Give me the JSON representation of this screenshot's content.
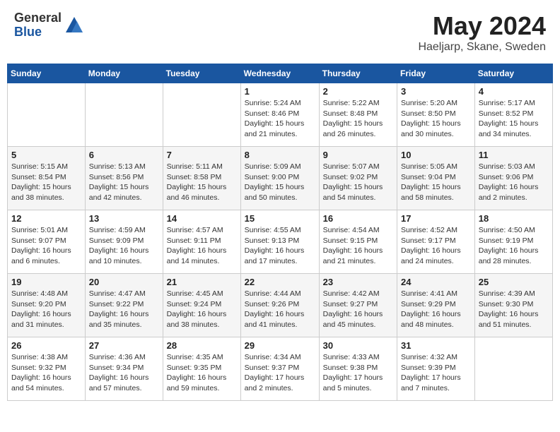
{
  "logo": {
    "general": "General",
    "blue": "Blue"
  },
  "title": "May 2024",
  "subtitle": "Haeljarp, Skane, Sweden",
  "days_header": [
    "Sunday",
    "Monday",
    "Tuesday",
    "Wednesday",
    "Thursday",
    "Friday",
    "Saturday"
  ],
  "weeks": [
    [
      {
        "num": "",
        "info": ""
      },
      {
        "num": "",
        "info": ""
      },
      {
        "num": "",
        "info": ""
      },
      {
        "num": "1",
        "info": "Sunrise: 5:24 AM\nSunset: 8:46 PM\nDaylight: 15 hours\nand 21 minutes."
      },
      {
        "num": "2",
        "info": "Sunrise: 5:22 AM\nSunset: 8:48 PM\nDaylight: 15 hours\nand 26 minutes."
      },
      {
        "num": "3",
        "info": "Sunrise: 5:20 AM\nSunset: 8:50 PM\nDaylight: 15 hours\nand 30 minutes."
      },
      {
        "num": "4",
        "info": "Sunrise: 5:17 AM\nSunset: 8:52 PM\nDaylight: 15 hours\nand 34 minutes."
      }
    ],
    [
      {
        "num": "5",
        "info": "Sunrise: 5:15 AM\nSunset: 8:54 PM\nDaylight: 15 hours\nand 38 minutes."
      },
      {
        "num": "6",
        "info": "Sunrise: 5:13 AM\nSunset: 8:56 PM\nDaylight: 15 hours\nand 42 minutes."
      },
      {
        "num": "7",
        "info": "Sunrise: 5:11 AM\nSunset: 8:58 PM\nDaylight: 15 hours\nand 46 minutes."
      },
      {
        "num": "8",
        "info": "Sunrise: 5:09 AM\nSunset: 9:00 PM\nDaylight: 15 hours\nand 50 minutes."
      },
      {
        "num": "9",
        "info": "Sunrise: 5:07 AM\nSunset: 9:02 PM\nDaylight: 15 hours\nand 54 minutes."
      },
      {
        "num": "10",
        "info": "Sunrise: 5:05 AM\nSunset: 9:04 PM\nDaylight: 15 hours\nand 58 minutes."
      },
      {
        "num": "11",
        "info": "Sunrise: 5:03 AM\nSunset: 9:06 PM\nDaylight: 16 hours\nand 2 minutes."
      }
    ],
    [
      {
        "num": "12",
        "info": "Sunrise: 5:01 AM\nSunset: 9:07 PM\nDaylight: 16 hours\nand 6 minutes."
      },
      {
        "num": "13",
        "info": "Sunrise: 4:59 AM\nSunset: 9:09 PM\nDaylight: 16 hours\nand 10 minutes."
      },
      {
        "num": "14",
        "info": "Sunrise: 4:57 AM\nSunset: 9:11 PM\nDaylight: 16 hours\nand 14 minutes."
      },
      {
        "num": "15",
        "info": "Sunrise: 4:55 AM\nSunset: 9:13 PM\nDaylight: 16 hours\nand 17 minutes."
      },
      {
        "num": "16",
        "info": "Sunrise: 4:54 AM\nSunset: 9:15 PM\nDaylight: 16 hours\nand 21 minutes."
      },
      {
        "num": "17",
        "info": "Sunrise: 4:52 AM\nSunset: 9:17 PM\nDaylight: 16 hours\nand 24 minutes."
      },
      {
        "num": "18",
        "info": "Sunrise: 4:50 AM\nSunset: 9:19 PM\nDaylight: 16 hours\nand 28 minutes."
      }
    ],
    [
      {
        "num": "19",
        "info": "Sunrise: 4:48 AM\nSunset: 9:20 PM\nDaylight: 16 hours\nand 31 minutes."
      },
      {
        "num": "20",
        "info": "Sunrise: 4:47 AM\nSunset: 9:22 PM\nDaylight: 16 hours\nand 35 minutes."
      },
      {
        "num": "21",
        "info": "Sunrise: 4:45 AM\nSunset: 9:24 PM\nDaylight: 16 hours\nand 38 minutes."
      },
      {
        "num": "22",
        "info": "Sunrise: 4:44 AM\nSunset: 9:26 PM\nDaylight: 16 hours\nand 41 minutes."
      },
      {
        "num": "23",
        "info": "Sunrise: 4:42 AM\nSunset: 9:27 PM\nDaylight: 16 hours\nand 45 minutes."
      },
      {
        "num": "24",
        "info": "Sunrise: 4:41 AM\nSunset: 9:29 PM\nDaylight: 16 hours\nand 48 minutes."
      },
      {
        "num": "25",
        "info": "Sunrise: 4:39 AM\nSunset: 9:30 PM\nDaylight: 16 hours\nand 51 minutes."
      }
    ],
    [
      {
        "num": "26",
        "info": "Sunrise: 4:38 AM\nSunset: 9:32 PM\nDaylight: 16 hours\nand 54 minutes."
      },
      {
        "num": "27",
        "info": "Sunrise: 4:36 AM\nSunset: 9:34 PM\nDaylight: 16 hours\nand 57 minutes."
      },
      {
        "num": "28",
        "info": "Sunrise: 4:35 AM\nSunset: 9:35 PM\nDaylight: 16 hours\nand 59 minutes."
      },
      {
        "num": "29",
        "info": "Sunrise: 4:34 AM\nSunset: 9:37 PM\nDaylight: 17 hours\nand 2 minutes."
      },
      {
        "num": "30",
        "info": "Sunrise: 4:33 AM\nSunset: 9:38 PM\nDaylight: 17 hours\nand 5 minutes."
      },
      {
        "num": "31",
        "info": "Sunrise: 4:32 AM\nSunset: 9:39 PM\nDaylight: 17 hours\nand 7 minutes."
      },
      {
        "num": "",
        "info": ""
      }
    ]
  ]
}
